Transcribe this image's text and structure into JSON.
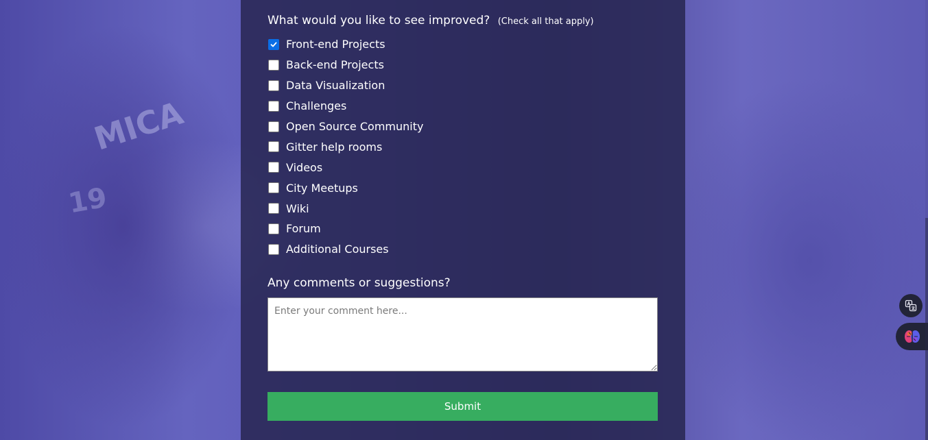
{
  "survey": {
    "improve_question": "What would you like to see improved?",
    "improve_hint": "(Check all that apply)",
    "options": [
      {
        "label": "Front-end Projects",
        "checked": true
      },
      {
        "label": "Back-end Projects",
        "checked": false
      },
      {
        "label": "Data Visualization",
        "checked": false
      },
      {
        "label": "Challenges",
        "checked": false
      },
      {
        "label": "Open Source Community",
        "checked": false
      },
      {
        "label": "Gitter help rooms",
        "checked": false
      },
      {
        "label": "Videos",
        "checked": false
      },
      {
        "label": "City Meetups",
        "checked": false
      },
      {
        "label": "Wiki",
        "checked": false
      },
      {
        "label": "Forum",
        "checked": false
      },
      {
        "label": "Additional Courses",
        "checked": false
      }
    ],
    "comments_label": "Any comments or suggestions?",
    "comments_placeholder": "Enter your comment here...",
    "comments_value": "",
    "submit_label": "Submit"
  },
  "background_text": {
    "shirt_text": "MICA",
    "shirt_number": "19"
  },
  "colors": {
    "panel": "#28264f",
    "submit": "#37ad60",
    "checkbox_checked": "#0a6ee6",
    "background": "#5a56b4"
  },
  "icons": {
    "check": "check-icon",
    "translate": "translate-icon",
    "ai_assistant": "brain-icon"
  }
}
